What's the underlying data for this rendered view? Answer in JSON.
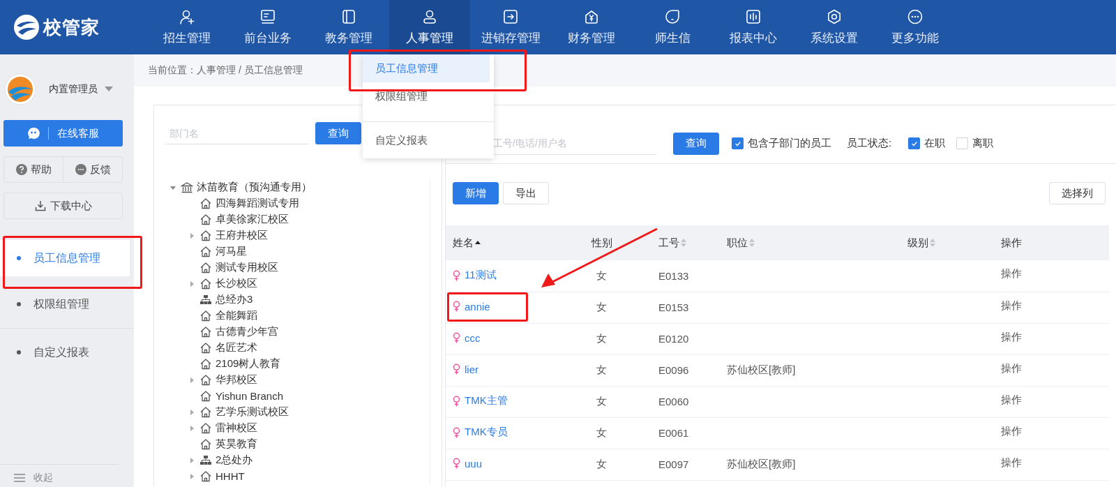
{
  "brand": {
    "name": "校管家"
  },
  "nav": [
    {
      "label": "招生管理",
      "selected": false
    },
    {
      "label": "前台业务",
      "selected": false
    },
    {
      "label": "教务管理",
      "selected": false
    },
    {
      "label": "人事管理",
      "selected": true
    },
    {
      "label": "进销存管理",
      "selected": false
    },
    {
      "label": "财务管理",
      "selected": false
    },
    {
      "label": "师生信",
      "selected": false
    },
    {
      "label": "报表中心",
      "selected": false
    },
    {
      "label": "系统设置",
      "selected": false
    },
    {
      "label": "更多功能",
      "selected": false
    }
  ],
  "dropdown": {
    "items": [
      {
        "label": "员工信息管理",
        "selected": true,
        "divider_above": false
      },
      {
        "label": "权限组管理",
        "selected": false,
        "divider_above": false
      },
      {
        "label": "自定义报表",
        "selected": false,
        "divider_above": true
      }
    ]
  },
  "sidebar": {
    "user": "内置管理员",
    "service_button": "在线客服",
    "help_button": "帮助",
    "feedback_button": "反馈",
    "download_button": "下载中心",
    "items": [
      {
        "label": "员工信息管理",
        "selected": true,
        "divider_above": false
      },
      {
        "label": "权限组管理",
        "selected": false,
        "divider_above": false
      },
      {
        "label": "自定义报表",
        "selected": false,
        "divider_above": true
      }
    ],
    "collapse": "收起"
  },
  "breadcrumb": "当前位置：人事管理 / 员工信息管理",
  "dept_panel": {
    "search": {
      "placeholder": "部门名"
    },
    "search_button": "查询",
    "tree": [
      {
        "label": "沐苗教育（预沟通专用）",
        "kind": "bank",
        "expanded": true,
        "children": [
          {
            "label": "四海舞蹈测试专用",
            "kind": "house"
          },
          {
            "label": "卓美徐家汇校区",
            "kind": "house"
          },
          {
            "label": "王府井校区",
            "kind": "house",
            "expanded": false
          },
          {
            "label": "河马星",
            "kind": "house"
          },
          {
            "label": "测试专用校区",
            "kind": "house"
          },
          {
            "label": "长沙校区",
            "kind": "house",
            "expanded": false
          },
          {
            "label": "总经办3",
            "kind": "org"
          },
          {
            "label": "全能舞蹈",
            "kind": "house"
          },
          {
            "label": "古德青少年宫",
            "kind": "house"
          },
          {
            "label": "名匠艺术",
            "kind": "house"
          },
          {
            "label": "2109树人教育",
            "kind": "house"
          },
          {
            "label": "华邦校区",
            "kind": "house",
            "expanded": false
          },
          {
            "label": "Yishun Branch",
            "kind": "house"
          },
          {
            "label": "艺学乐测试校区",
            "kind": "house",
            "expanded": false
          },
          {
            "label": "雷神校区",
            "kind": "house",
            "expanded": false
          },
          {
            "label": "英昊教育",
            "kind": "house"
          },
          {
            "label": "2总处办",
            "kind": "org",
            "expanded": false
          },
          {
            "label": "HHHT",
            "kind": "house",
            "expanded": false
          }
        ]
      }
    ]
  },
  "staff_panel": {
    "search": {
      "placeholder": "工号/电话/用户名"
    },
    "search_button": "查询",
    "filters": [
      {
        "label": "包含子部门的员工",
        "checked": true
      }
    ],
    "status_label": "员工状态:",
    "status": [
      {
        "label": "在职",
        "checked": true
      },
      {
        "label": "离职",
        "checked": false
      }
    ],
    "add_button": "新增",
    "export_button": "导出",
    "columns_button": "选择列",
    "table": {
      "columns": [
        {
          "label": "姓名",
          "sortable": true,
          "sorted": true
        },
        {
          "label": "性别",
          "sortable": false,
          "sorted": false
        },
        {
          "label": "工号",
          "sortable": true,
          "sorted": false
        },
        {
          "label": "职位",
          "sortable": true,
          "sorted": false
        },
        {
          "label": "级别",
          "sortable": true,
          "sorted": false
        },
        {
          "label": "操作",
          "sortable": false,
          "sorted": false
        }
      ],
      "rows": [
        {
          "name": "11测试",
          "gender": "女",
          "id": "E0133",
          "action": "操作"
        },
        {
          "name": "annie",
          "gender": "女",
          "id": "E0153",
          "action": "操作"
        },
        {
          "name": "ccc",
          "gender": "女",
          "id": "E0120",
          "action": "操作"
        },
        {
          "name": "lier",
          "gender": "女",
          "id": "E0096",
          "position": "苏仙校区[教师]",
          "action": "操作"
        },
        {
          "name": "TMK主管",
          "gender": "女",
          "id": "E0060",
          "action": "操作"
        },
        {
          "name": "TMK专员",
          "gender": "女",
          "id": "E0061",
          "action": "操作"
        },
        {
          "name": "uuu",
          "gender": "女",
          "id": "E0097",
          "position": "苏仙校区[教师]",
          "action": "操作"
        }
      ]
    }
  },
  "annotations": [
    {
      "kind": "box"
    },
    {
      "kind": "box"
    },
    {
      "kind": "box"
    },
    {
      "kind": "arrow"
    }
  ]
}
